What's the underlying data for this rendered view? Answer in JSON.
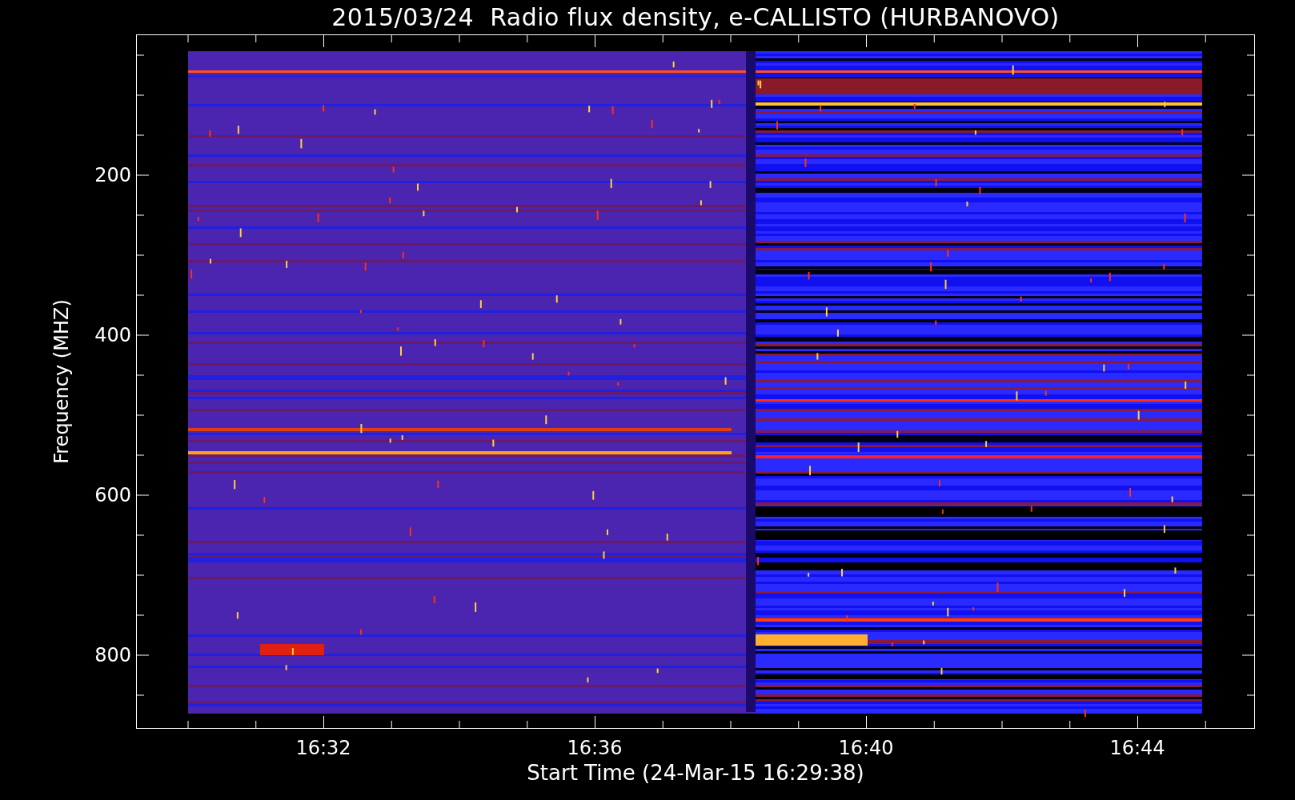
{
  "title": "2015/03/24  Radio flux density, e-CALLISTO (HURBANOVO)",
  "y_axis": {
    "label": "Frequency (MHZ)",
    "ticks": [
      "200",
      "400",
      "600",
      "800"
    ]
  },
  "x_axis": {
    "label": "Start Time (24-Mar-15 16:29:38)",
    "ticks": [
      "16:32",
      "16:36",
      "16:40",
      "16:44"
    ]
  }
}
